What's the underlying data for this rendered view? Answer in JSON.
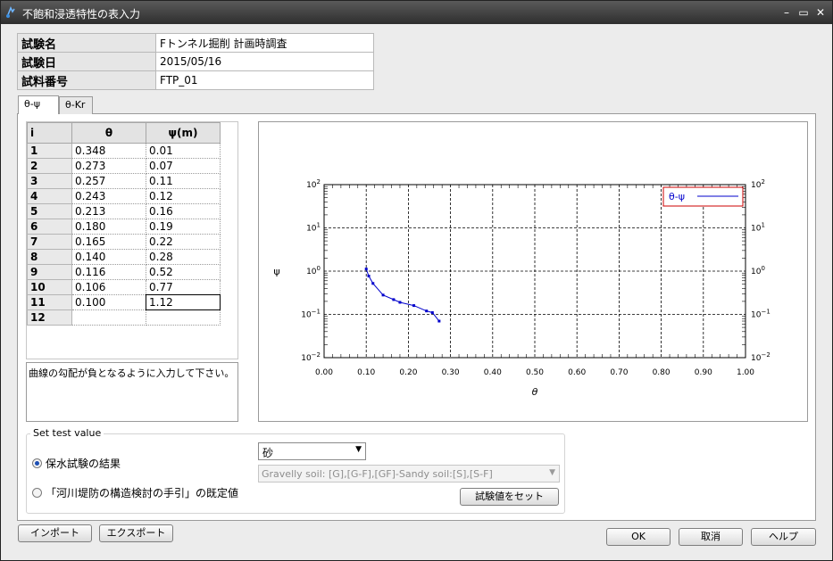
{
  "window": {
    "title": "不飽和浸透特性の表入力"
  },
  "info": {
    "rows": [
      {
        "label": "試験名",
        "value": "Fトンネル掘削 計画時調査"
      },
      {
        "label": "試験日",
        "value": "2015/05/16"
      },
      {
        "label": "試料番号",
        "value": "FTP_01"
      }
    ]
  },
  "tabs": [
    {
      "label": "θ-ψ"
    },
    {
      "label": "θ-Kr"
    }
  ],
  "grid": {
    "headers": [
      "i",
      "θ",
      "ψ(m)"
    ],
    "rows": [
      [
        "1",
        "0.348",
        "0.01"
      ],
      [
        "2",
        "0.273",
        "0.07"
      ],
      [
        "3",
        "0.257",
        "0.11"
      ],
      [
        "4",
        "0.243",
        "0.12"
      ],
      [
        "5",
        "0.213",
        "0.16"
      ],
      [
        "6",
        "0.180",
        "0.19"
      ],
      [
        "7",
        "0.165",
        "0.22"
      ],
      [
        "8",
        "0.140",
        "0.28"
      ],
      [
        "9",
        "0.116",
        "0.52"
      ],
      [
        "10",
        "0.106",
        "0.77"
      ],
      [
        "11",
        "0.100",
        "1.12"
      ],
      [
        "12",
        "",
        ""
      ]
    ]
  },
  "memo": "曲線の勾配が負となるように入力して下さい。",
  "chart_data": {
    "type": "line",
    "title": "",
    "xlabel": "θ",
    "ylabel": "ψ",
    "xlim": [
      0,
      1
    ],
    "ylim": [
      0.01,
      100
    ],
    "yscale": "log",
    "grid": true,
    "legend_placement": "top-right",
    "x_ticks": [
      "0.00",
      "0.10",
      "0.20",
      "0.30",
      "0.40",
      "0.50",
      "0.60",
      "0.70",
      "0.80",
      "0.90",
      "1.00"
    ],
    "y_ticks": [
      {
        "base": "10",
        "exp": "2"
      },
      {
        "base": "10",
        "exp": "1"
      },
      {
        "base": "10",
        "exp": "0"
      },
      {
        "base": "10",
        "exp": "−1"
      },
      {
        "base": "10",
        "exp": "−2"
      }
    ],
    "series": [
      {
        "name": "θ-ψ",
        "color": "#0000cc",
        "x": [
          0.1,
          0.106,
          0.116,
          0.14,
          0.165,
          0.18,
          0.213,
          0.243,
          0.257,
          0.273
        ],
        "y": [
          1.12,
          0.77,
          0.52,
          0.28,
          0.22,
          0.19,
          0.16,
          0.12,
          0.11,
          0.07
        ]
      }
    ]
  },
  "settings": {
    "group_title": "Set test value",
    "radio1": "保水試験の結果",
    "radio2": "「河川堤防の構造検討の手引」の既定値",
    "radio_selected": 1,
    "soil_select": "砂",
    "soil_class": "Gravelly soil: [G],[G-F],[GF]-Sandy soil:[S],[S-F]",
    "set_button": "試験値をセット"
  },
  "buttons": {
    "import": "インポート",
    "export": "エクスポート",
    "ok": "OK",
    "cancel": "取消",
    "help": "ヘルプ"
  }
}
